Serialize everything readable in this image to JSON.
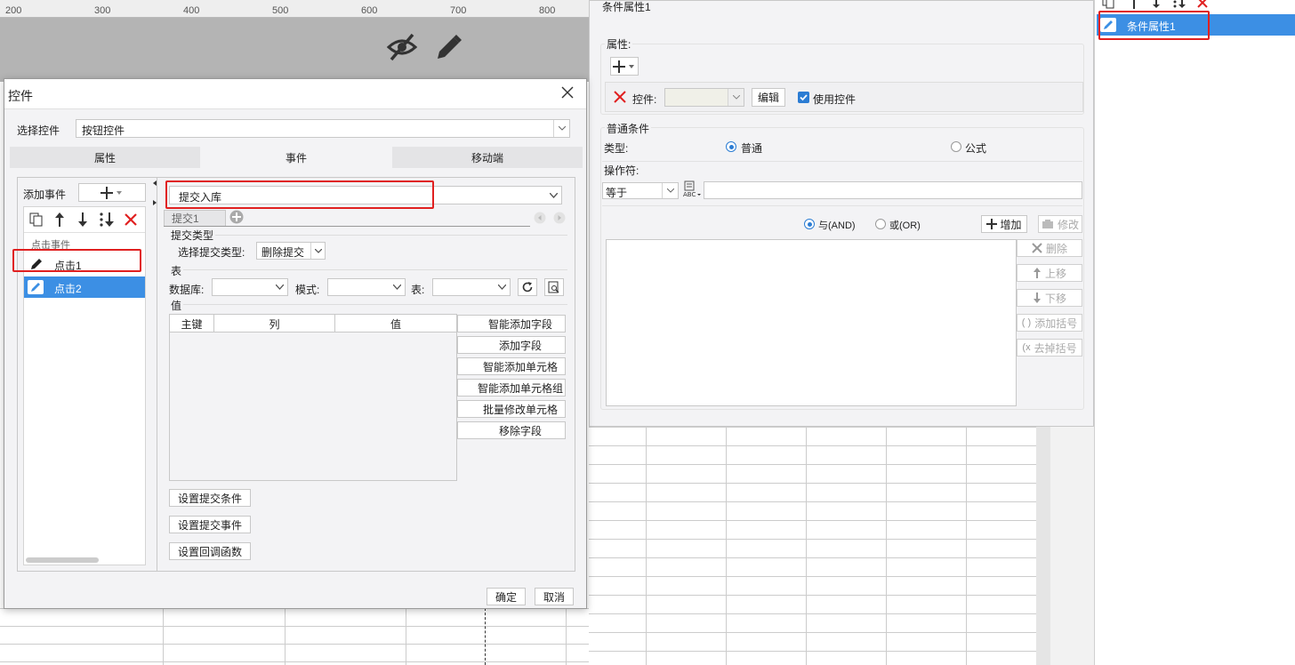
{
  "ruler": {
    "ticks": [
      "200",
      "300",
      "400",
      "500",
      "600",
      "700",
      "800"
    ]
  },
  "control_dialog": {
    "title": "控件",
    "select_label": "选择控件",
    "select_value": "按钮控件",
    "tabs": [
      {
        "label": "属性"
      },
      {
        "label": "事件"
      },
      {
        "label": "移动端"
      }
    ],
    "add_event_label": "添加事件",
    "event_group_label": "点击事件",
    "events": [
      {
        "label": "点击1"
      },
      {
        "label": "点击2"
      }
    ],
    "action_type": "提交入库",
    "submit_tab": "提交1",
    "submit_type_section": "提交类型",
    "submit_type_label": "选择提交类型:",
    "submit_type_value": "删除提交",
    "table_section": "表",
    "db_label": "数据库:",
    "schema_label": "模式:",
    "table_label": "表:",
    "value_section": "值",
    "columns": [
      "主键",
      "列",
      "值"
    ],
    "side_buttons": [
      {
        "label": "智能添加字段"
      },
      {
        "label": "添加字段"
      },
      {
        "label": "智能添加单元格"
      },
      {
        "label": "智能添加单元格组"
      },
      {
        "label": "批量修改单元格"
      },
      {
        "label": "移除字段"
      }
    ],
    "bottom_buttons": [
      {
        "label": "设置提交条件"
      },
      {
        "label": "设置提交事件"
      },
      {
        "label": "设置回调函数"
      }
    ],
    "ok": "确定",
    "cancel": "取消"
  },
  "condition_dialog": {
    "title": "条件属性1",
    "prop_section": "属性:",
    "control_label": "控件:",
    "edit_button": "编辑",
    "use_control_label": "使用控件",
    "normal_section": "普通条件",
    "type_label": "类型:",
    "type_normal": "普通",
    "type_formula": "公式",
    "operator_label": "操作符:",
    "operator_value": "等于",
    "and_label": "与(AND)",
    "or_label": "或(OR)",
    "add_button": "增加",
    "modify_button": "修改",
    "action_buttons": [
      {
        "label": "删除"
      },
      {
        "label": "上移"
      },
      {
        "label": "下移"
      },
      {
        "label": "添加括号"
      },
      {
        "label": "去掉括号"
      }
    ]
  },
  "condition_list": {
    "items": [
      {
        "label": "条件属性1"
      }
    ]
  },
  "colors": {
    "accent": "#3c8fe4",
    "highlight": "#e02020",
    "check": "#2b7cd3"
  }
}
